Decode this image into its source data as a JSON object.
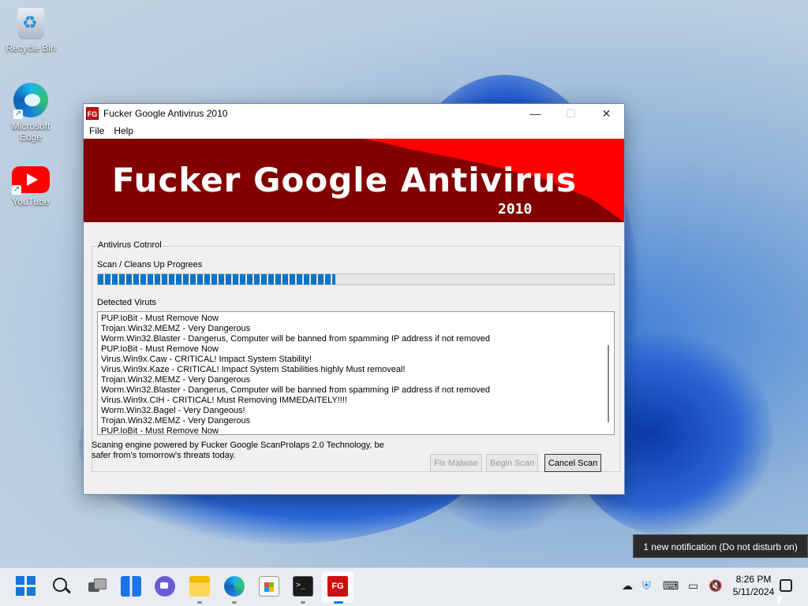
{
  "desktop": {
    "icons": [
      {
        "label": "Recycle Bin"
      },
      {
        "label": "Microsoft Edge"
      },
      {
        "label": "YouTube"
      }
    ]
  },
  "window": {
    "title": "Fucker Google Antivirus 2010",
    "app_icon_text": "FG",
    "controls": {
      "minimize": "—",
      "maximize": "☐",
      "close": "✕"
    },
    "menu": [
      "File",
      "Help"
    ],
    "banner": {
      "title": "Fucker Google Antivirus",
      "year": "2010"
    },
    "group_label": "Antivirus Cotnrol",
    "scan_label": "Scan / Cleans Up Progrees",
    "progress_percent": 46,
    "detected_label": "Detected Viruts",
    "detected_items": [
      "PUP.IoBit - Must Remove Now",
      "Trojan.Win32.MEMZ - Very Dangerous",
      "Worm.Win32.Blaster - Dangerus, Computer will be banned from spamming IP address if not removed",
      "PUP.IoBit - Must Remove Now",
      "Virus.Win9x.Caw - CRITICAL! Impact System Stability!",
      "Virus.Win9x.Kaze - CRITICAL! Impact System Stabilities highly Must removeal!",
      "Trojan.Win32.MEMZ - Very Dangerous",
      "Worm.Win32.Blaster - Dangerus, Computer will be banned from spamming IP address if not removed",
      "Virus.Win9x.CIH - CRITICAL! Must Removing IMMEDAITELY!!!!",
      "Worm.Win32.Bagel - Very Dangeous!",
      "Trojan.Win32.MEMZ - Very Dangerous",
      "PUP.IoBit - Must Remove Now"
    ],
    "footer_line1": "Scaning engine powered by Fucker Google ScanProlaps 2.0 Technology, be",
    "footer_line2": "safer from's tomorrow's threats today.",
    "buttons": {
      "fix": "Fix Malwae",
      "begin": "Begin Scan",
      "cancel": "Cancel Scan"
    }
  },
  "notification": {
    "text": "1 new notification (Do not disturb on)"
  },
  "taskbar": {
    "fg_text": "FG",
    "terminal_text": ">_",
    "time": "8:26 PM",
    "date": "5/11/2024",
    "tray_icons": [
      "cloud-offline-icon",
      "defender-icon",
      "keyboard-icon",
      "network-icon",
      "volume-muted-icon",
      "notification-bell-icon"
    ]
  },
  "colors": {
    "banner_dark": "#820000",
    "banner_bright": "#ff0000",
    "progress": "#0a73c8",
    "accent": "#1a73e8"
  }
}
